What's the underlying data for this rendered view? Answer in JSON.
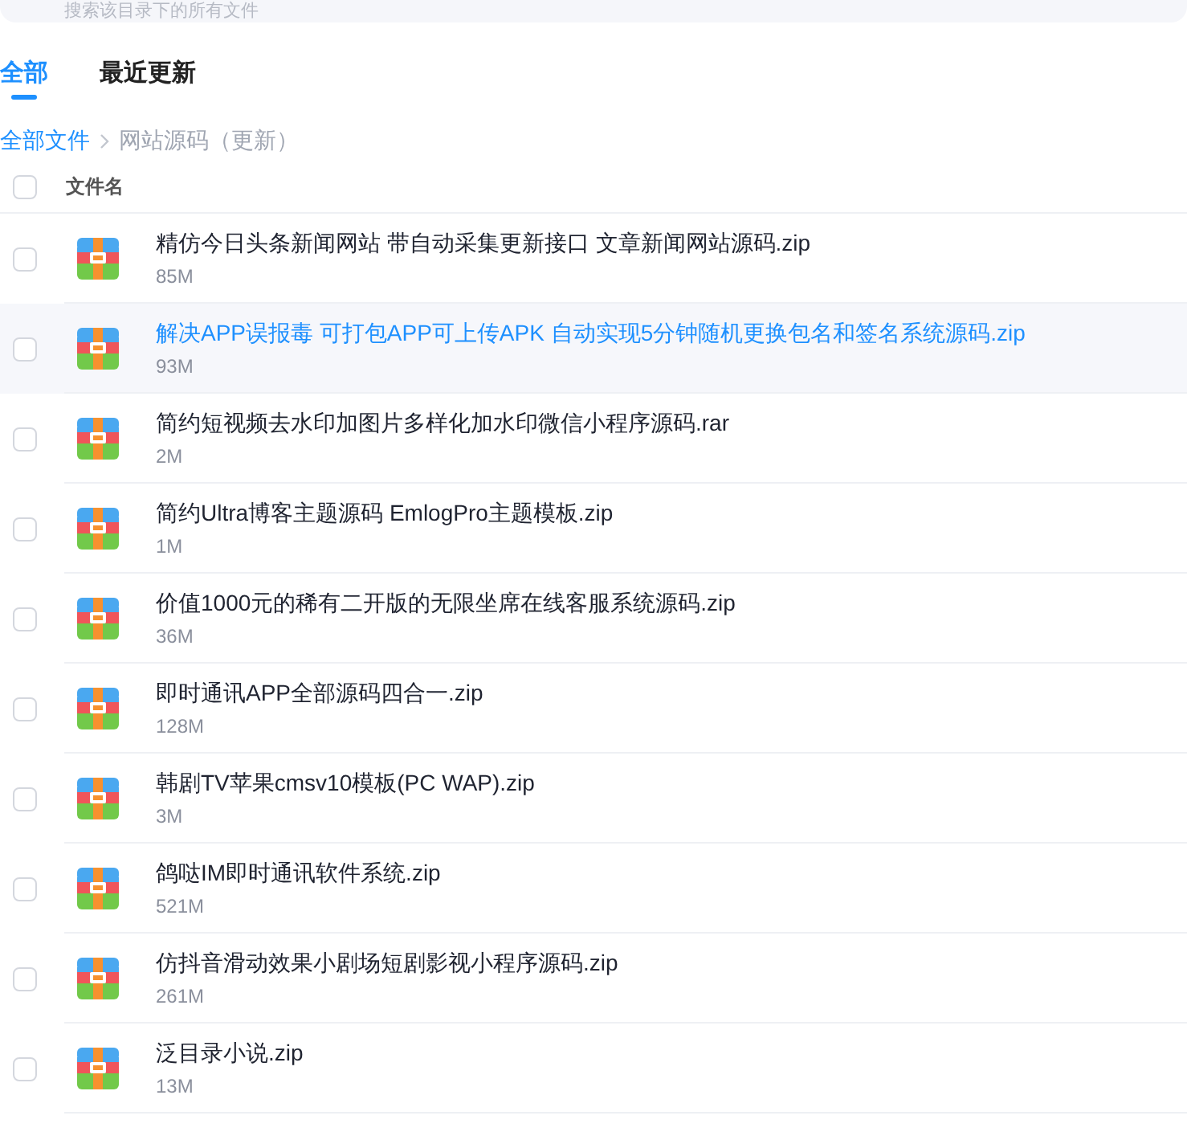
{
  "search": {
    "placeholder": "搜索该目录下的所有文件"
  },
  "tabs": [
    {
      "label": "全部",
      "selected": true
    },
    {
      "label": "最近更新",
      "selected": false
    }
  ],
  "breadcrumb": [
    {
      "label": "全部文件",
      "current": false
    },
    {
      "label": "网站源码（更新）",
      "current": true
    }
  ],
  "table": {
    "select_all": {
      "checked": false
    },
    "columns": [
      "文件名"
    ],
    "rows": [
      {
        "name": "精仿今日头条新闻网站 带自动采集更新接口 文章新闻网站源码.zip",
        "size": "85M",
        "checked": false,
        "highlighted": false
      },
      {
        "name": "解决APP误报毒 可打包APP可上传APK 自动实现5分钟随机更换包名和签名系统源码.zip",
        "size": "93M",
        "checked": false,
        "highlighted": true
      },
      {
        "name": "简约短视频去水印加图片多样化加水印微信小程序源码.rar",
        "size": "2M",
        "checked": false,
        "highlighted": false
      },
      {
        "name": "简约Ultra博客主题源码 EmlogPro主题模板.zip",
        "size": "1M",
        "checked": false,
        "highlighted": false
      },
      {
        "name": "价值1000元的稀有二开版的无限坐席在线客服系统源码.zip",
        "size": "36M",
        "checked": false,
        "highlighted": false
      },
      {
        "name": "即时通讯APP全部源码四合一.zip",
        "size": "128M",
        "checked": false,
        "highlighted": false
      },
      {
        "name": "韩剧TV苹果cmsv10模板(PC WAP).zip",
        "size": "3M",
        "checked": false,
        "highlighted": false
      },
      {
        "name": "鸽哒IM即时通讯软件系统.zip",
        "size": "521M",
        "checked": false,
        "highlighted": false
      },
      {
        "name": "仿抖音滑动效果小剧场短剧影视小程序源码.zip",
        "size": "261M",
        "checked": false,
        "highlighted": false
      },
      {
        "name": "泛目录小说.zip",
        "size": "13M",
        "checked": false,
        "highlighted": false
      }
    ]
  }
}
